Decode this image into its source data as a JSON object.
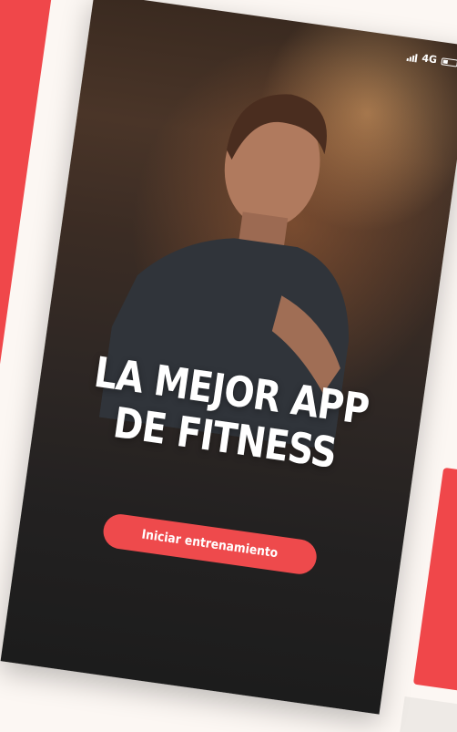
{
  "status_bar": {
    "network_label": "4G"
  },
  "main": {
    "headline_line1": "LA MEJOR APP",
    "headline_line2": "DE FITNESS",
    "cta_label": "Iniciar entrenamiento"
  },
  "colors": {
    "accent": "#ee4a4c",
    "background": "#fcf7f3",
    "text_on_dark": "#ffffff"
  },
  "icons": [
    "signal-icon",
    "battery-icon"
  ]
}
